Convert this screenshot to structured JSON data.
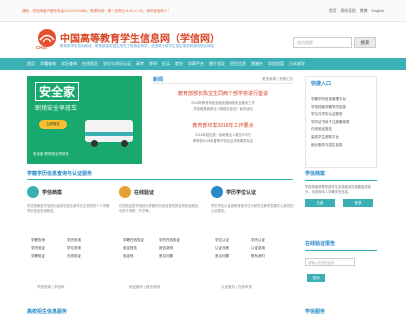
{
  "topbar": {
    "notice": "通知：学信网客户服务电话010-67410388，受理时间：周一至周五 8:30-17:00，请勿轻信他人！",
    "links": [
      "首页",
      "网站导航",
      "微博",
      "English"
    ]
  },
  "header": {
    "logo_en": "CHSI",
    "title": "中国高等教育学生信息网（学信网）",
    "subtitle": "教育部学历查询网站、教育部高校招生阳光工程指定网站、全国硕士研究生招生报名和调剂指定网站",
    "search_placeholder": "站内搜索",
    "search_button": "搜索"
  },
  "nav": {
    "items": [
      "首页",
      "学籍查询",
      "学历查询",
      "在线验证",
      "学位与学历认证",
      "高考",
      "考研",
      "征兵",
      "就业",
      "学职平台",
      "图片验证",
      "招生信息",
      "港澳台",
      "学信档案",
      "日本留学"
    ]
  },
  "banner": {
    "title": "安全家",
    "subtitle": "职场安全早班车",
    "button": "立即报名",
    "footer": "安全家 职场安全早班车"
  },
  "news": {
    "title": "新闻",
    "more": "更多新闻 | 专题汇总",
    "headline": "教育部部长陈宝生同两个部学校进行座谈",
    "summary_lines": [
      "2018年教育系统全面加强网络安全建设工作",
      "学信网受邀参加《网络安全法》宣传活动"
    ],
    "headline2": "教育部印发2018年工作要点",
    "summary2": [
      "2018年招生统一高考报名人数达975万",
      "教育部2018年春季开学后召开新闻发布会"
    ]
  },
  "quick": {
    "title": "快捷入口",
    "items": [
      "学籍学历信息管理平台",
      "学信档案学籍学历信息",
      "学位与学历认证服务",
      "学历证书电子注册备案表",
      "在线验证报告",
      "高校学生资助平台",
      "就业服务与招生信息"
    ]
  },
  "section": {
    "title": "学籍学历信息查询与认证服务",
    "columns": [
      {
        "title": "学信档案",
        "desc": "学信档案是学信网为高校在校生和毕业生提供的个人学籍学历信息查询服务。",
        "links": [
          "学籍查询",
          "学历查询",
          "学历验证",
          "学位查询",
          "学籍验证",
          "在线验证"
        ],
        "foot": "学信档案 | 学信网"
      },
      {
        "title": "在线验证",
        "desc": "在线验证是学信网为学籍学历信息提供的在线验证服务，可用于求职、升学等。",
        "links": [
          "学籍在线验证",
          "学历在线验证",
          "验证报告",
          "报告说明",
          "验证码",
          "常见问题"
        ],
        "foot": "验证服务 | 报告说明"
      },
      {
        "title": "学历学位认证",
        "desc": "学历学位认证是教育部学位与研究生教育发展中心提供的认证服务。",
        "links": [
          "学位认证",
          "学历认证",
          "认证流程",
          "认证费用",
          "常见问题",
          "联系我们"
        ],
        "foot": "认证服务 | 在线申请"
      }
    ]
  },
  "files": {
    "title": "学信档案",
    "desc": "学信档案是教育部学生信息服务的重要组成部分，可查询本人学籍学历信息。",
    "buttons": [
      "注册",
      "登录"
    ]
  },
  "online": {
    "title": "在线验证报告",
    "input_placeholder": "请输入在线验证码",
    "button": "查询"
  },
  "bottom": {
    "left": "高校招生信息服务",
    "right": "学信服务"
  },
  "colors": {
    "accent": "#3bb0b4",
    "brand_red": "#d94424",
    "link_blue": "#2a8bc9",
    "banner_green": "#19a96e"
  }
}
